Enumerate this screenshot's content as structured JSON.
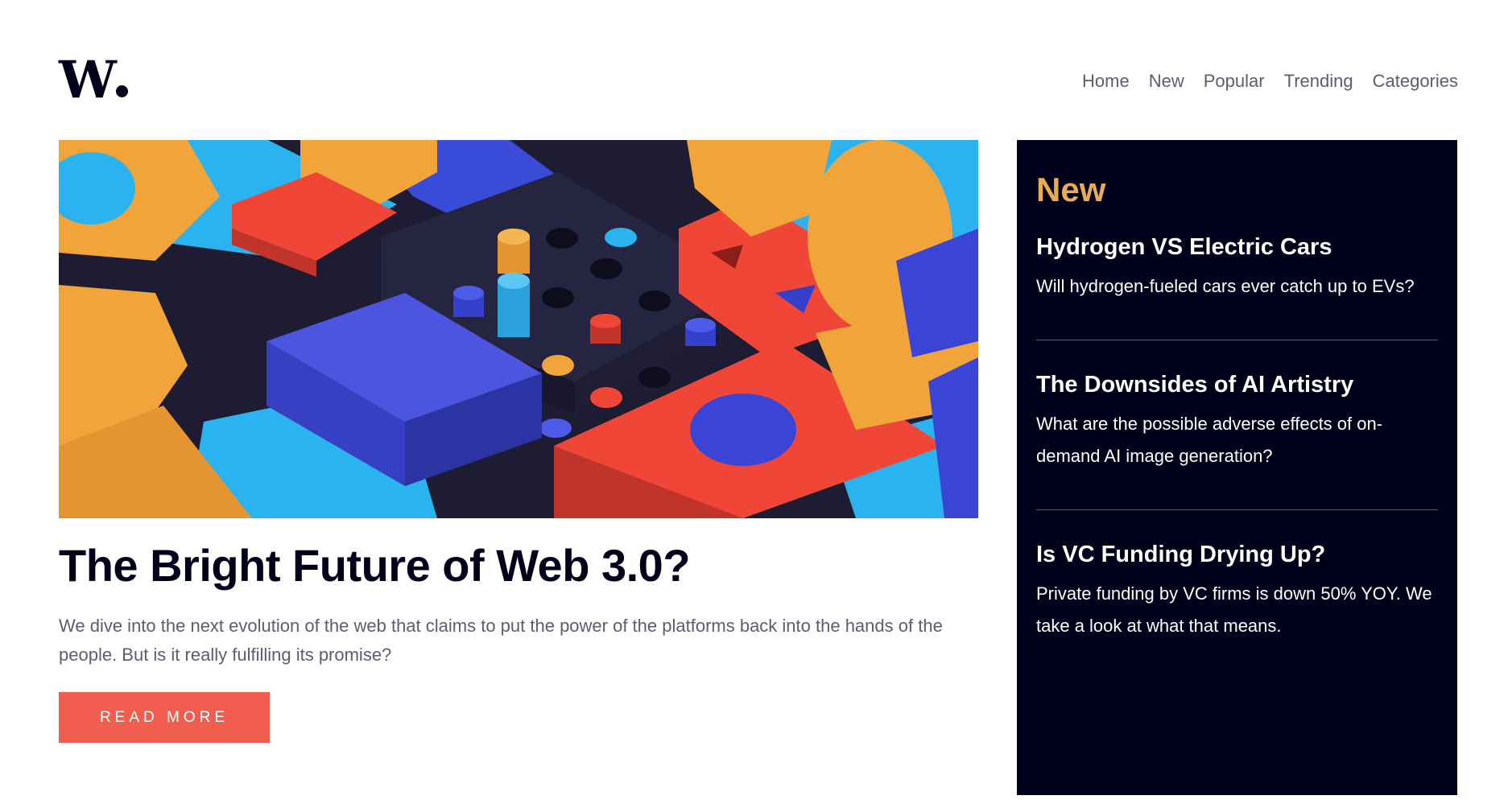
{
  "header": {
    "logo_text": "W",
    "nav": [
      {
        "label": "Home"
      },
      {
        "label": "New"
      },
      {
        "label": "Popular"
      },
      {
        "label": "Trending"
      },
      {
        "label": "Categories"
      }
    ]
  },
  "main": {
    "image_icon": "abstract-3d-blocks-illustration",
    "title": "The Bright Future of Web 3.0?",
    "description": "We dive into the next evolution of the web that claims to put the power of the platforms back into the hands of the people. But is it really fulfilling its promise?",
    "read_more_label": "READ MORE"
  },
  "sidebar": {
    "heading": "New",
    "items": [
      {
        "title": "Hydrogen VS Electric Cars",
        "description": "Will hydrogen-fueled cars ever catch up to EVs?"
      },
      {
        "title": "The Downsides of AI Artistry",
        "description": "What are the possible adverse effects of on-demand AI image generation?"
      },
      {
        "title": "Is VC Funding Drying Up?",
        "description": "Private funding by VC firms is down 50% YOY. We take a look at what that means."
      }
    ]
  },
  "colors": {
    "brand_dark": "#00001a",
    "accent_orange": "#e9ab53",
    "button_red": "#f15e50",
    "text_gray": "#5b5d70",
    "white": "#ffffff"
  }
}
